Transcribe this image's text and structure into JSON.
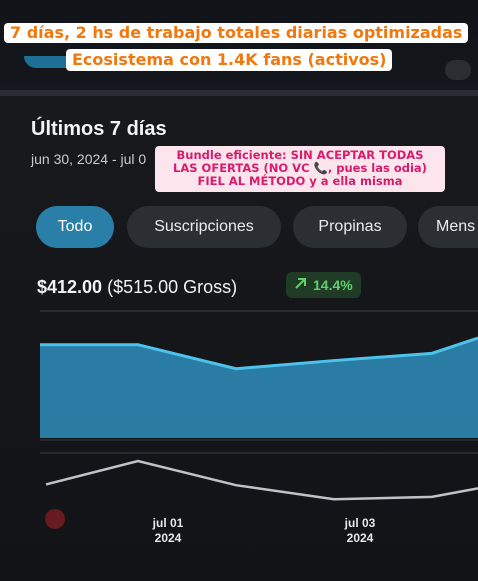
{
  "overlay": {
    "line1": "7 días, 2 hs de trabajo totales diarias optimizadas",
    "line2": "Ecosistema  con 1.4K fans (activos)",
    "note_line1": "Bundle eficiente: SIN ACEPTAR TODAS",
    "note_line2": "LAS OFERTAS (NO VC 📞, pues las odia)",
    "note_line3": "FIEL AL MÉTODO y a ella misma"
  },
  "section": {
    "title": "Últimos 7 días",
    "date_range": "jun 30, 2024 - jul 0"
  },
  "tabs": [
    {
      "label": "Todo",
      "active": true
    },
    {
      "label": "Suscripciones",
      "active": false
    },
    {
      "label": "Propinas",
      "active": false
    },
    {
      "label": "Mens",
      "active": false
    }
  ],
  "summary": {
    "net": "$412.00",
    "gross": "($515.00 Gross)",
    "change": "14.4%",
    "change_icon": "arrow-up-right-icon",
    "change_color": "#5fd16b"
  },
  "colors": {
    "accent": "#2a7fa8",
    "area_fill": "#2c86b0",
    "area_line": "#4cc3ea",
    "nav_line": "#bfc3c8"
  },
  "chart_data": {
    "type": "area",
    "x_tick_labels": [
      {
        "line1": "jul 01",
        "line2": "2024"
      },
      {
        "line1": "jul 03",
        "line2": "2024"
      }
    ],
    "main_series_shape": [
      0.86,
      0.86,
      0.36,
      0.53,
      0.68,
      1.0
    ],
    "navigator_series_shape": [
      0.4,
      1.0,
      0.38,
      0.02,
      0.08,
      0.3
    ]
  }
}
